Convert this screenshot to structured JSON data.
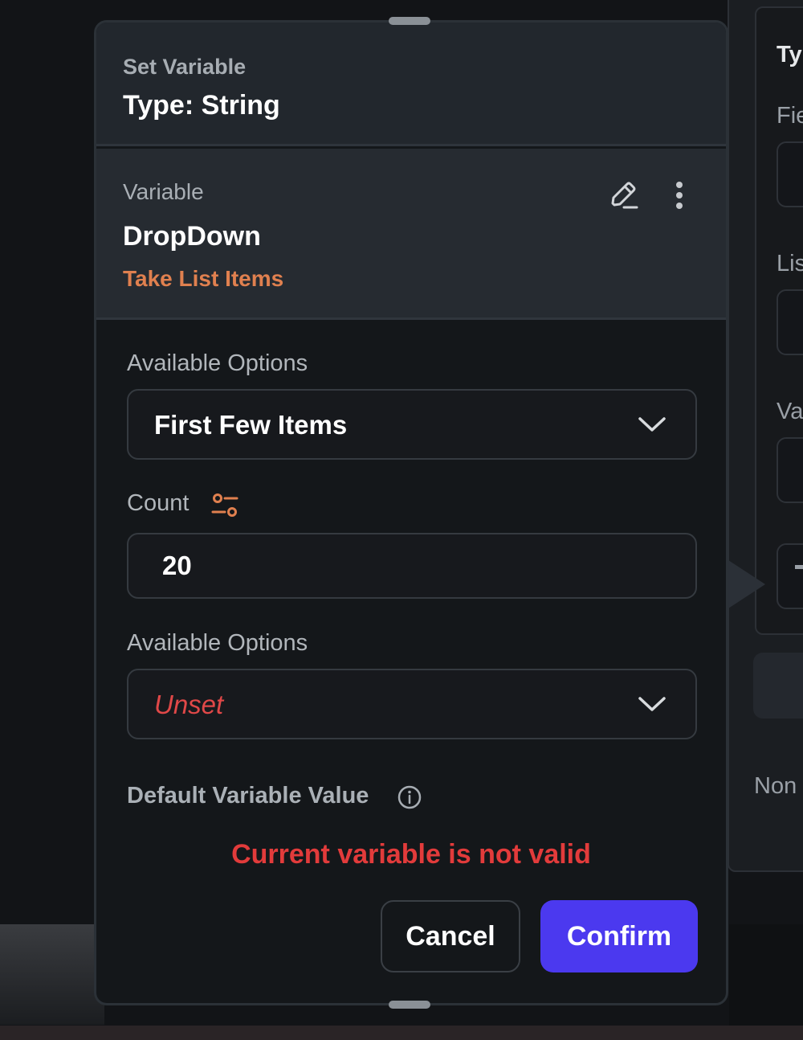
{
  "dialog": {
    "subtitle": "Set Variable",
    "title": "Type: String"
  },
  "variable": {
    "label": "Variable",
    "name": "DropDown",
    "operation": "Take List Items",
    "edit_icon": "pencil-icon",
    "more_icon": "more-vertical-icon"
  },
  "options1": {
    "label": "Available Options",
    "selected": "First Few Items",
    "icon": "chevron-down-icon"
  },
  "count": {
    "label": "Count",
    "icon": "sliders-icon",
    "value": "20"
  },
  "options2": {
    "label": "Available Options",
    "selected": "Unset",
    "icon": "chevron-down-icon"
  },
  "default_value": {
    "label": "Default Variable Value",
    "icon": "info-icon"
  },
  "error": "Current variable is not valid",
  "buttons": {
    "cancel": "Cancel",
    "confirm": "Confirm"
  },
  "background_panel": {
    "labels": [
      "Ty",
      "Fie",
      "Lis",
      "Va",
      "Non"
    ]
  },
  "colors": {
    "accent": "#4b39ef",
    "error": "#e23b3b",
    "warning": "#e0804f"
  }
}
